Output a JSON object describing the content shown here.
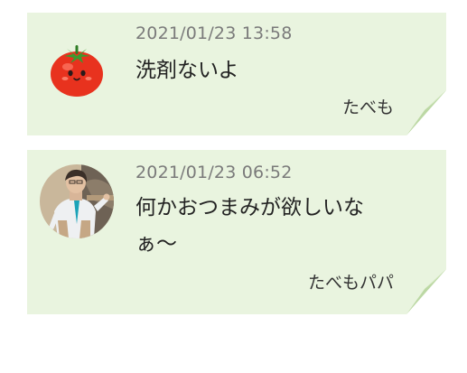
{
  "memos": [
    {
      "timestamp": "2021/01/23 13:58",
      "message_lines": [
        "洗剤ないよ"
      ],
      "author": "たべも",
      "avatar_icon": "tomato-character-icon"
    },
    {
      "timestamp": "2021/01/23 06:52",
      "message_lines": [
        "何かおつまみが欲しいな",
        "ぁ〜"
      ],
      "author": "たべもパパ",
      "avatar_icon": "anime-man-portrait-icon"
    }
  ],
  "colors": {
    "card_background": "#e9f4df",
    "curl_fold": "#bcd8a4",
    "tomato_red": "#e8321e",
    "stem_green": "#3c9a2f"
  }
}
